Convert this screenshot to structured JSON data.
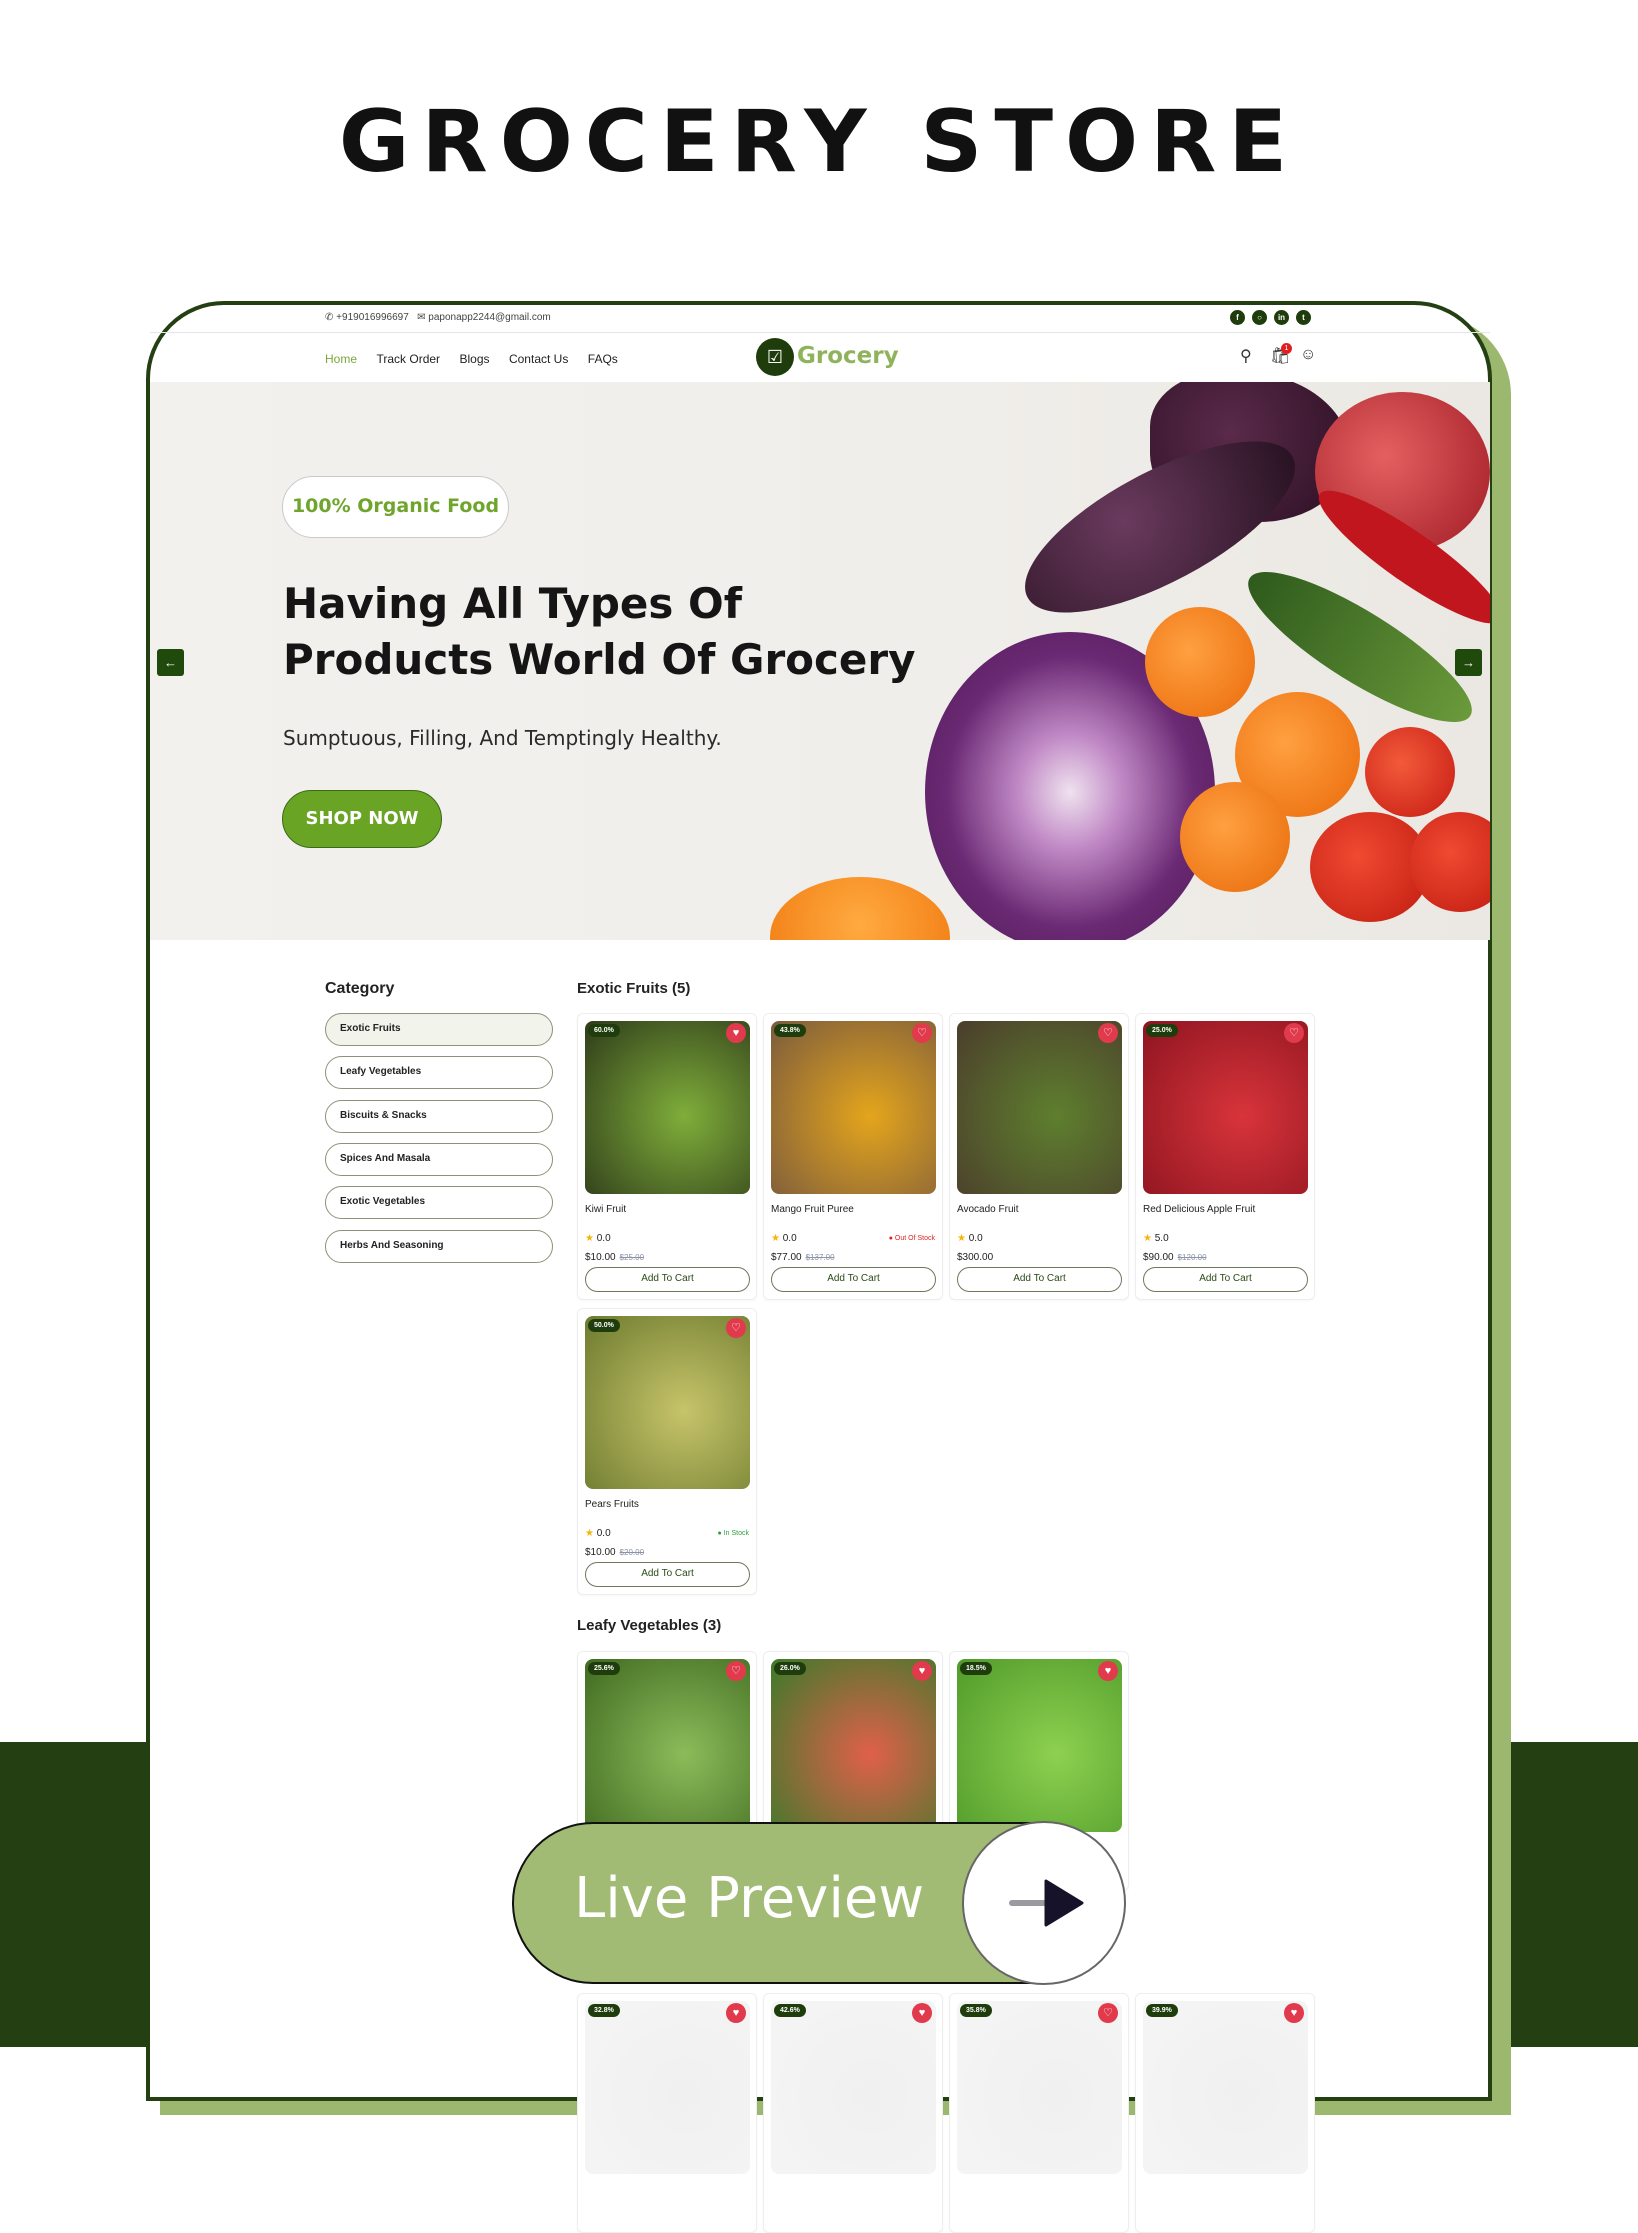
{
  "poster": {
    "title": "GROCERY STORE",
    "live_preview": "Live Preview"
  },
  "topbar": {
    "phone": "+919016996697",
    "email": "paponapp2244@gmail.com",
    "social": [
      "facebook-icon",
      "instagram-icon",
      "linkedin-icon",
      "twitter-icon"
    ]
  },
  "nav": {
    "items": [
      "Home",
      "Track Order",
      "Blogs",
      "Contact Us",
      "FAQs"
    ],
    "active": "Home",
    "logo": "Grocery",
    "cart_count": "1"
  },
  "hero": {
    "badge": "100% Organic Food",
    "heading_line1": "Having All Types Of",
    "heading_line2": "Products World Of Grocery",
    "subtitle": "Sumptuous, Filling, And Temptingly Healthy.",
    "cta": "SHOP NOW"
  },
  "sidebar": {
    "title": "Category",
    "items": [
      "Exotic Fruits",
      "Leafy Vegetables",
      "Biscuits & Snacks",
      "Spices And Masala",
      "Exotic Vegetables",
      "Herbs And Seasoning"
    ],
    "active": "Exotic Fruits"
  },
  "sections": [
    {
      "title": "Exotic Fruits (5)",
      "products": [
        {
          "discount": "60.0%",
          "name": "Kiwi Fruit",
          "rating": "0.0",
          "price": "$10.00",
          "old_price": "$25.00",
          "stock": "",
          "wish": true,
          "photo": [
            "#2e3a1a",
            "#7fae3a"
          ]
        },
        {
          "discount": "43.8%",
          "name": "Mango Fruit Puree",
          "rating": "0.0",
          "price": "$77.00",
          "old_price": "$137.00",
          "stock": "Out Of Stock",
          "wish": false,
          "photo": [
            "#7a5a3e",
            "#e4a51c"
          ]
        },
        {
          "discount": "",
          "name": "Avocado Fruit",
          "rating": "0.0",
          "price": "$300.00",
          "old_price": "",
          "stock": "",
          "wish": false,
          "photo": [
            "#4b3d2c",
            "#5e7f2e"
          ]
        },
        {
          "discount": "25.0%",
          "name": "Red Delicious Apple Fruit",
          "rating": "5.0",
          "price": "$90.00",
          "old_price": "$120.00",
          "stock": "",
          "wish": false,
          "photo": [
            "#8d1420",
            "#d8343a"
          ]
        },
        {
          "discount": "50.0%",
          "name": "Pears Fruits",
          "rating": "0.0",
          "price": "$10.00",
          "old_price": "$20.00",
          "stock": "In Stock",
          "wish": false,
          "photo": [
            "#6c7a2e",
            "#c7c46a"
          ]
        }
      ]
    },
    {
      "title": "Leafy Vegetables (3)",
      "products": [
        {
          "discount": "25.6%",
          "wish": false,
          "photo": [
            "#3f6a20",
            "#8cbb5a"
          ]
        },
        {
          "discount": "26.0%",
          "wish": true,
          "photo": [
            "#3a7a2a",
            "#e0604a"
          ]
        },
        {
          "discount": "18.5%",
          "wish": true,
          "photo": [
            "#4f9a2a",
            "#8ed150"
          ]
        }
      ]
    },
    {
      "title": "",
      "products": [
        {
          "discount": "32.8%",
          "wish": true,
          "photo": [
            "#f5f5f5",
            "#f0f0f0"
          ]
        },
        {
          "discount": "42.6%",
          "wish": true,
          "photo": [
            "#f5f5f5",
            "#f0f0f0"
          ]
        },
        {
          "discount": "35.8%",
          "wish": false,
          "photo": [
            "#f5f5f5",
            "#f0f0f0"
          ]
        },
        {
          "discount": "39.9%",
          "wish": true,
          "photo": [
            "#f5f5f5",
            "#f0f0f0"
          ]
        }
      ]
    }
  ],
  "labels": {
    "add_to_cart": "Add To Cart"
  },
  "colors": {
    "brand_dark": "#1f3d0c",
    "accent": "#7aa83a",
    "cta": "#6aa424",
    "wishlist": "#e03a4c",
    "out_of_stock": "#e02020",
    "in_stock": "#2a9d3a"
  }
}
